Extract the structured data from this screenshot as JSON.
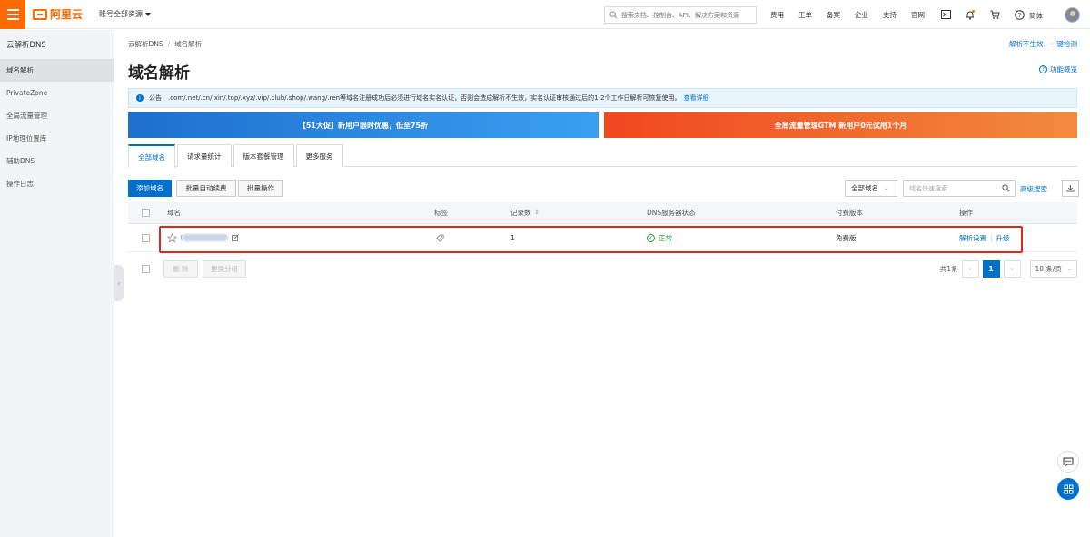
{
  "topbar": {
    "logo_text": "阿里云",
    "account_label": "账号全部资源",
    "search_placeholder": "搜索文档、控制台、API、解决方案和资源",
    "nav": [
      "费用",
      "工单",
      "备案",
      "企业",
      "支持",
      "官网"
    ],
    "icons": [
      "terminal-icon",
      "bell-icon",
      "cart-icon",
      "help-icon"
    ],
    "lang": "简体",
    "accent_color": "#ff6a00"
  },
  "sidebar": {
    "title": "云解析DNS",
    "items": [
      {
        "label": "域名解析",
        "active": true
      },
      {
        "label": "PrivateZone",
        "active": false
      },
      {
        "label": "全局流量管理",
        "active": false
      },
      {
        "label": "IP地理位置库",
        "active": false
      },
      {
        "label": "辅助DNS",
        "active": false
      },
      {
        "label": "操作日志",
        "active": false
      }
    ]
  },
  "breadcrumb": {
    "root": "云解析DNS",
    "sep": "/",
    "current": "域名解析"
  },
  "top_right_link": "解析不生效，一键检测",
  "page_title": "域名解析",
  "overview_link": "功能概览",
  "notice": {
    "text": "公告：.com/.net/.cn/.xin/.top/.xyz/.vip/.club/.shop/.wang/.ren等域名注册成功后必须进行域名实名认证，否则会造成解析不生效，实名认证审核通过后的1-2个工作日解析可恢复使用。",
    "link": "查看详细"
  },
  "banners": {
    "left": "【51大促】新用户限时优惠，低至75折",
    "right": "全局流量管理GTM 新用户0元试用1个月"
  },
  "tabs": [
    "全部域名",
    "请求量统计",
    "版本套餐管理",
    "更多服务"
  ],
  "toolbar": {
    "add_domain": "添加域名",
    "batch_renew": "批量自动续费",
    "batch_ops": "批量操作",
    "domain_select": "全部域名",
    "filter_placeholder": "域名快速搜索",
    "advanced_search": "高级搜索"
  },
  "table": {
    "headers": {
      "domain": "域名",
      "tag": "标签",
      "records": "记录数",
      "dns_status": "DNS服务器状态",
      "edition": "付费版本",
      "actions": "操作"
    },
    "rows": [
      {
        "domain_prefix": "[",
        "records": "1",
        "dns_status": "正常",
        "edition": "免费版",
        "action_set": "解析设置",
        "action_upgrade": "升级"
      }
    ]
  },
  "footer": {
    "delete": "删 除",
    "change_group": "更换分组",
    "total": "共1条",
    "current_page": "1",
    "page_size": "10 条/页"
  }
}
